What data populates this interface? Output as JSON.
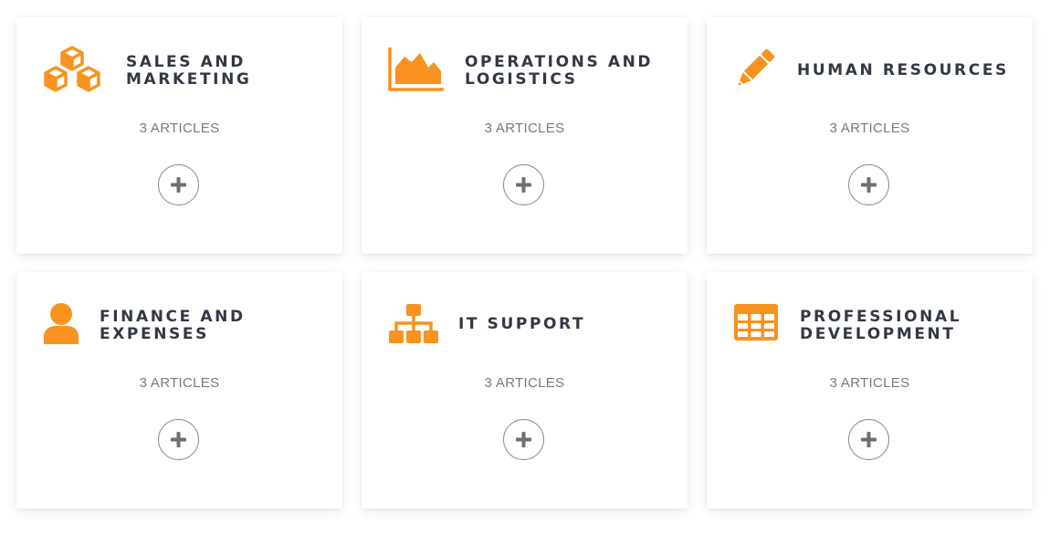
{
  "accent_color": "#f7931e",
  "categories": [
    {
      "title": "SALES AND\nMARKETING",
      "count": "3 ARTICLES",
      "icon": "cubes-icon"
    },
    {
      "title": "OPERATIONS AND\nLOGISTICS",
      "count": "3 ARTICLES",
      "icon": "area-chart-icon"
    },
    {
      "title": "HUMAN RESOURCES",
      "count": "3 ARTICLES",
      "icon": "pencil-icon"
    },
    {
      "title": "FINANCE AND\nEXPENSES",
      "count": "3 ARTICLES",
      "icon": "user-icon"
    },
    {
      "title": "IT SUPPORT",
      "count": "3 ARTICLES",
      "icon": "sitemap-icon"
    },
    {
      "title": "PROFESSIONAL\nDEVELOPMENT",
      "count": "3 ARTICLES",
      "icon": "table-icon"
    }
  ],
  "expand_button_icon": "plus-icon"
}
